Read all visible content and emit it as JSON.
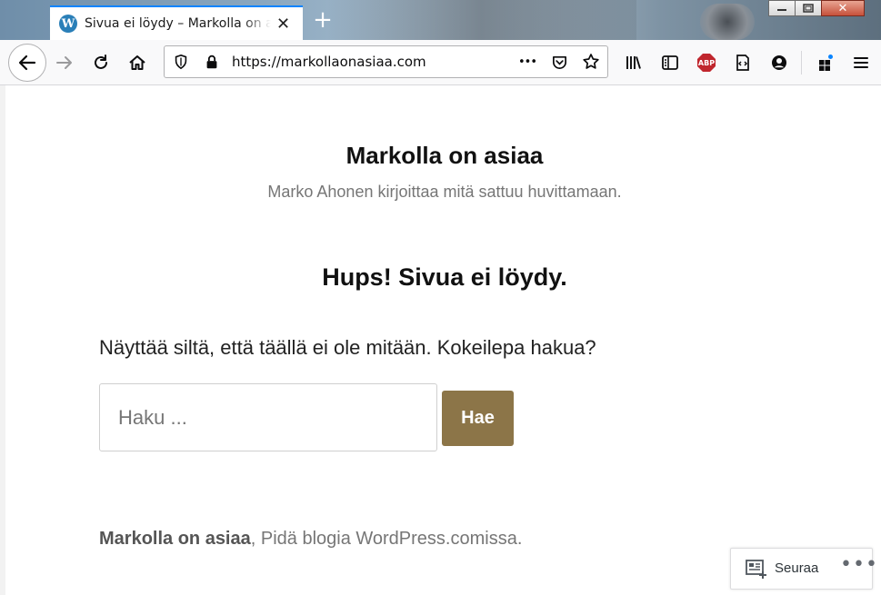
{
  "browser": {
    "tab": {
      "title": "Sivua ei löydy – Markolla on asiaa",
      "favicon": "wordpress-icon",
      "close_glyph": "✕"
    },
    "new_tab_glyph": "+",
    "url": "https://markollaonasiaa.com",
    "page_actions_glyph": "•••",
    "abp_label": "ABP",
    "window_controls": {
      "close_glyph": "✕"
    },
    "accent_color": "#0a84ff"
  },
  "page": {
    "site_title": "Markolla on asiaa",
    "site_description": "Marko Ahonen kirjoittaa mitä sattuu huvittamaan.",
    "heading": "Hups! Sivua ei löydy.",
    "message": "Näyttää siltä, että täällä ei ole mitään. Kokeilepa hakua?",
    "search": {
      "placeholder": "Haku ...",
      "button_label": "Hae",
      "button_color": "#8c7548"
    },
    "footer": {
      "site_link": "Markolla on asiaa",
      "text": ", Pidä blogia WordPress.comissa."
    },
    "follow_widget": {
      "label": "Seuraa",
      "more_glyph": "•••"
    }
  }
}
